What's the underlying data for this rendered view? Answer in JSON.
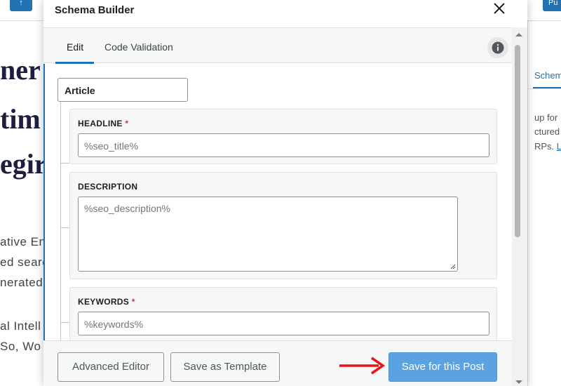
{
  "background": {
    "top_left_button": "↑",
    "top_right_button": "Pu",
    "headline_lines": [
      "ner",
      "tim",
      "egir"
    ],
    "paragraph_lines": [
      "ative En",
      "ed searc",
      "nerated",
      "al Intell",
      "So, Wo"
    ],
    "sidebar_tab": "Schem",
    "sidebar_lines": [
      "up for",
      "ctured",
      "RPs. "
    ],
    "sidebar_link": "Le"
  },
  "modal": {
    "title": "Schema Builder",
    "tabs": [
      {
        "label": "Edit",
        "active": true
      },
      {
        "label": "Code Validation",
        "active": false
      }
    ],
    "schema_type": "Article",
    "fields": [
      {
        "label": "HEADLINE",
        "required": true,
        "value": "%seo_title%",
        "kind": "input"
      },
      {
        "label": "DESCRIPTION",
        "required": false,
        "value": "%seo_description%",
        "kind": "textarea"
      },
      {
        "label": "KEYWORDS",
        "required": true,
        "value": "%keywords%",
        "kind": "input"
      }
    ],
    "required_marker": "*",
    "footer": {
      "advanced_editor": "Advanced Editor",
      "save_as_template": "Save as Template",
      "save_for_post": "Save for this Post"
    }
  },
  "colors": {
    "accent": "#2271b1",
    "primary_button": "#5ba3e0",
    "required": "#d63638",
    "annotation_arrow": "#e8141c"
  },
  "icons": [
    "close-icon",
    "info-icon",
    "scroll-up-arrow-icon",
    "scroll-down-arrow-icon",
    "resize-grip-icon",
    "annotation-arrow-icon"
  ]
}
